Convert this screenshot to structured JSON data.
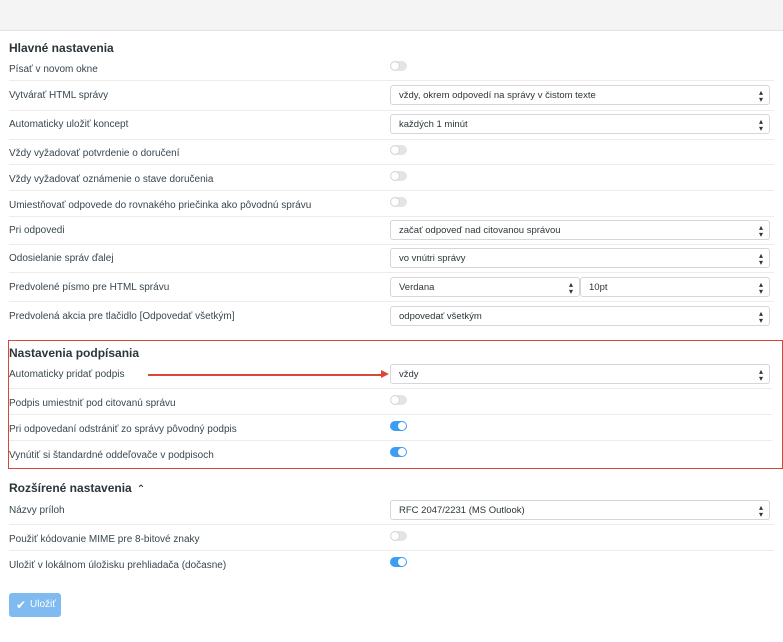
{
  "sections": {
    "main": {
      "title": "Hlavné nastavenia"
    },
    "signing": {
      "title": "Nastavenia podpísania"
    },
    "advanced": {
      "title": "Rozšírené nastavenia",
      "chevron": "chevron-up-icon"
    }
  },
  "rows": {
    "compose_new_window": {
      "label": "Písať v novom okne",
      "on": false
    },
    "compose_html": {
      "label": "Vytvárať HTML správy",
      "value": "vždy, okrem odpovedí na správy v čistom texte"
    },
    "draft_autosave": {
      "label": "Automaticky uložiť koncept",
      "value": "každých 1 minút"
    },
    "mdn_default": {
      "label": "Vždy vyžadovať potvrdenie o doručení",
      "on": false
    },
    "dsn_default": {
      "label": "Vždy vyžadovať oznámenie o stave doručenia",
      "on": false
    },
    "reply_same_folder": {
      "label": "Umiestňovať odpovede do rovnakého priečinka ako pôvodnú správu",
      "on": false
    },
    "reply_mode": {
      "label": "Pri odpovedi",
      "value": "začať odpoveď nad citovanou správou"
    },
    "forward_attachment": {
      "label": "Odosielanie správ ďalej",
      "value": "vo vnútri správy"
    },
    "default_font": {
      "label": "Predvolené písmo pre HTML správu",
      "font": "Verdana",
      "size": "10pt"
    },
    "reply_all": {
      "label": "Predvolená akcia pre tlačidlo [Odpovedať všetkým]",
      "value": "odpovedať všetkým"
    },
    "show_sig": {
      "label": "Automaticky pridať podpis",
      "value": "vždy"
    },
    "sig_below": {
      "label": "Podpis umiestniť pod citovanú správu",
      "on": false
    },
    "strip_sig": {
      "label": "Pri odpovedaní odstrániť zo správy pôvodný podpis",
      "on": true
    },
    "sig_separator": {
      "label": "Vynútiť si štandardné oddeľovače v podpisoch",
      "on": true
    },
    "mime_names": {
      "label": "Názvy príloh",
      "value": "RFC 2047/2231 (MS Outlook)"
    },
    "force_7bit": {
      "label": "Použiť kódovanie MIME pre 8-bitové znaky",
      "on": false
    },
    "local_storage": {
      "label": "Uložiť v lokálnom úložisku prehliadača (dočasne)",
      "on": true
    }
  },
  "save_button": {
    "label": "Uložiť",
    "icon": "checkmark-icon"
  },
  "colors": {
    "accent": "#3d9df2",
    "highlight": "#d9473b",
    "button": "#7fbaf0"
  }
}
